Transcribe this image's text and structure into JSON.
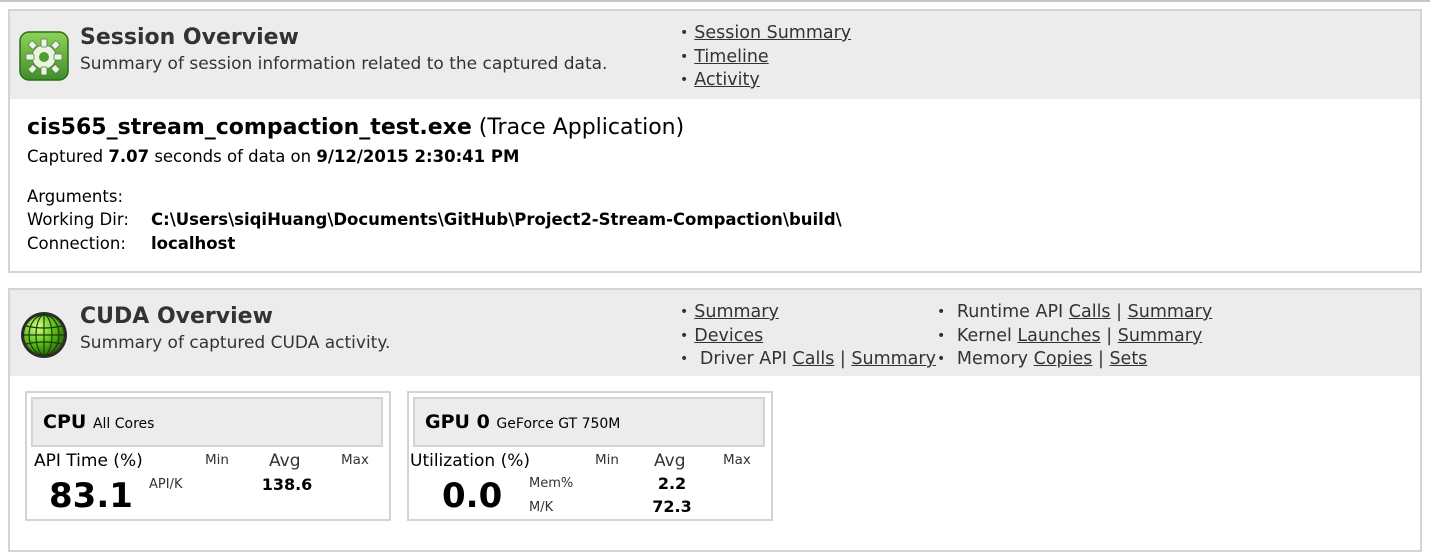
{
  "session": {
    "title": "Session Overview",
    "subtitle": "Summary of session information related to the captured data.",
    "links": [
      "Session Summary",
      "Timeline",
      "Activity"
    ],
    "app_name": "cis565_stream_compaction_test.exe",
    "app_type": "(Trace Application)",
    "captured_prefix": "Captured",
    "captured_seconds": "7.07",
    "captured_middle": "seconds of data on",
    "captured_datetime": "9/12/2015 2:30:41 PM",
    "arguments_label": "Arguments:",
    "arguments_value": "",
    "workdir_label": "Working Dir:",
    "workdir_value": "C:\\Users\\siqiHuang\\Documents\\GitHub\\Project2-Stream-Compaction\\build\\",
    "connection_label": "Connection:",
    "connection_value": "localhost",
    "icon": "gear-icon"
  },
  "cuda": {
    "title": "CUDA Overview",
    "subtitle": "Summary of captured CUDA activity.",
    "icon": "cuda-globe-icon",
    "links_col1": {
      "summary": "Summary",
      "devices": "Devices",
      "driver_prefix": "Driver API",
      "driver_calls": "Calls",
      "driver_summary": "Summary",
      "sep": "|"
    },
    "links_col2": {
      "runtime_prefix": "Runtime API",
      "runtime_calls": "Calls",
      "runtime_summary": "Summary",
      "kernel_prefix": "Kernel",
      "kernel_launches": "Launches",
      "kernel_summary": "Summary",
      "memory_prefix": "Memory",
      "memory_copies": "Copies",
      "memory_sets": "Sets",
      "sep": "|"
    }
  },
  "cpu_card": {
    "title": "CPU",
    "subtitle": "All Cores",
    "metric": "API Time (%)",
    "min_label": "Min",
    "avg_label": "Avg",
    "max_label": "Max",
    "big_value": "83.1",
    "row1_label": "API/K",
    "row1_avg": "138.6"
  },
  "gpu_card": {
    "title": "GPU 0",
    "subtitle": "GeForce GT 750M",
    "metric": "Utilization (%)",
    "min_label": "Min",
    "avg_label": "Avg",
    "max_label": "Max",
    "big_value": "0.0",
    "row1_label": "Mem%",
    "row1_avg": "2.2",
    "row2_label": "M/K",
    "row2_avg": "72.3"
  }
}
